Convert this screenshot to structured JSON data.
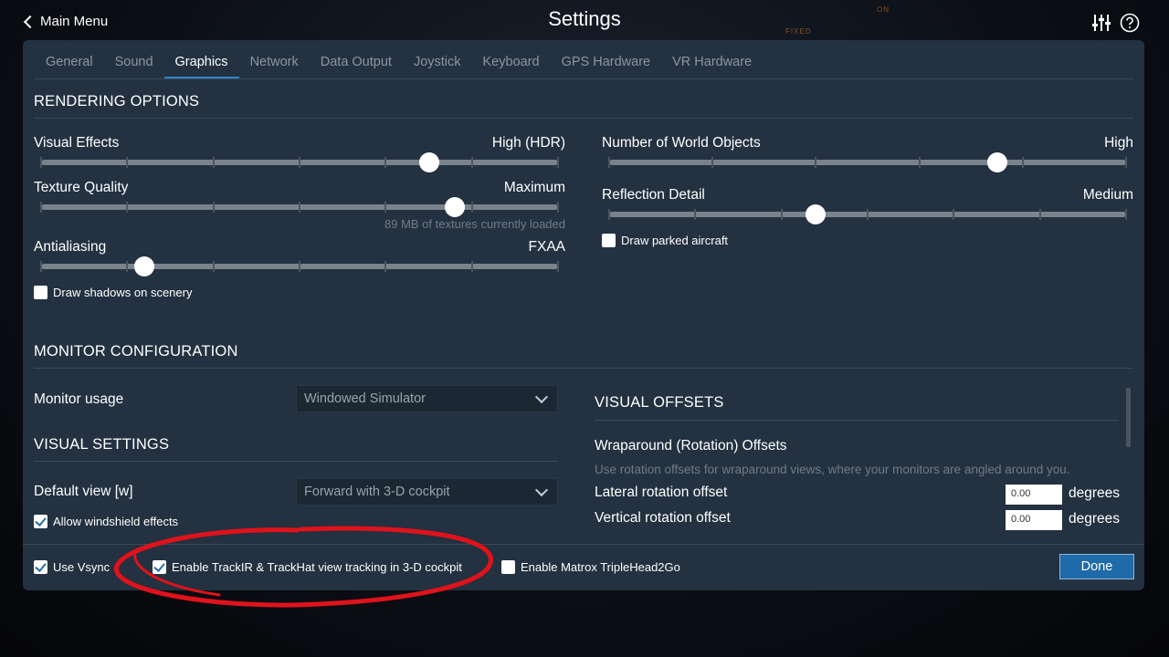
{
  "topbar": {
    "back_label": "Main Menu",
    "title": "Settings",
    "icons": [
      "sliders-icon",
      "help-icon"
    ]
  },
  "tabs": [
    {
      "label": "General",
      "active": false
    },
    {
      "label": "Sound",
      "active": false
    },
    {
      "label": "Graphics",
      "active": true
    },
    {
      "label": "Network",
      "active": false
    },
    {
      "label": "Data Output",
      "active": false
    },
    {
      "label": "Joystick",
      "active": false
    },
    {
      "label": "Keyboard",
      "active": false
    },
    {
      "label": "GPS Hardware",
      "active": false
    },
    {
      "label": "VR Hardware",
      "active": false
    }
  ],
  "rendering": {
    "title": "RENDERING OPTIONS",
    "visual_effects": {
      "label": "Visual Effects",
      "value": "High (HDR)",
      "level": 0.75
    },
    "texture_quality": {
      "label": "Texture Quality",
      "value": "Maximum",
      "level": 0.8,
      "note": "89 MB of textures currently loaded"
    },
    "antialiasing": {
      "label": "Antialiasing",
      "value": "FXAA",
      "level": 0.2
    },
    "draw_shadows": {
      "label": "Draw shadows on scenery",
      "checked": false
    },
    "world_objects": {
      "label": "Number of World Objects",
      "value": "High",
      "level": 0.75
    },
    "reflection_detail": {
      "label": "Reflection Detail",
      "value": "Medium",
      "level": 0.4
    },
    "draw_parked": {
      "label": "Draw parked aircraft",
      "checked": false
    }
  },
  "monitor": {
    "title": "MONITOR CONFIGURATION",
    "usage_label": "Monitor usage",
    "usage_value": "Windowed Simulator"
  },
  "visual_settings": {
    "title": "VISUAL SETTINGS",
    "default_view_label": "Default view [w]",
    "default_view_value": "Forward with 3-D cockpit",
    "windshield": {
      "label": "Allow windshield effects",
      "checked": true
    }
  },
  "visual_offsets": {
    "title": "VISUAL OFFSETS",
    "subtitle": "Wraparound (Rotation) Offsets",
    "description": "Use rotation offsets for wraparound views, where your monitors are angled around you.",
    "lateral": {
      "label": "Lateral rotation offset",
      "value": "0.00",
      "unit": "degrees"
    },
    "vertical": {
      "label": "Vertical rotation offset",
      "value": "0.00",
      "unit": "degrees"
    }
  },
  "footer": {
    "vsync": {
      "label": "Use Vsync",
      "checked": true
    },
    "trackir": {
      "label": "Enable TrackIR & TrackHat view tracking in 3-D cockpit",
      "checked": true
    },
    "matrox": {
      "label": "Enable Matrox TripleHead2Go",
      "checked": false
    },
    "done_label": "Done"
  },
  "colors": {
    "panel": "#233140",
    "accent": "#2e86c9",
    "annotation": "#e0121b"
  }
}
